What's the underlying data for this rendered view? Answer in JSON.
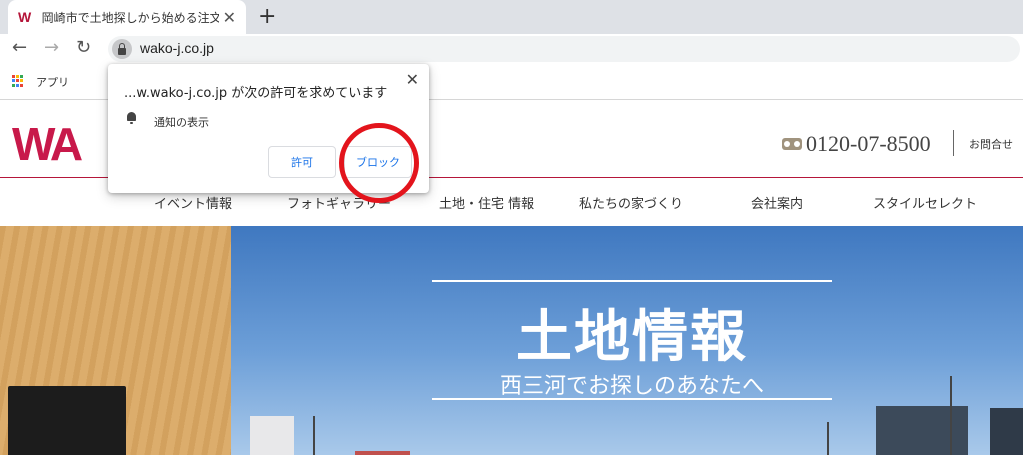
{
  "browser": {
    "tab_title": "岡崎市で土地探しから始める注文住",
    "tab_close": "✕",
    "new_tab": "+",
    "url": "wako-j.co.jp",
    "bookmarks_apps": "アプリ"
  },
  "site": {
    "logo": "WA",
    "phone": "0120-07-8500",
    "contact": "お問合せ",
    "brand_color": "#b5163a",
    "nav": [
      "イベント情報",
      "フォトギャラリー",
      "土地・住宅 情報",
      "私たちの家づくり",
      "会社案内",
      "スタイルセレクト"
    ]
  },
  "hero": {
    "title": "土地情報",
    "subtitle": "西三河でお探しのあなたへ"
  },
  "permission_popup": {
    "title": "...w.wako-j.co.jp が次の許可を求めています",
    "permission": "通知の表示",
    "allow": "許可",
    "block": "ブロック",
    "close": "✕",
    "icon": "bell-icon"
  },
  "annotation": {
    "color": "#e3141c"
  }
}
